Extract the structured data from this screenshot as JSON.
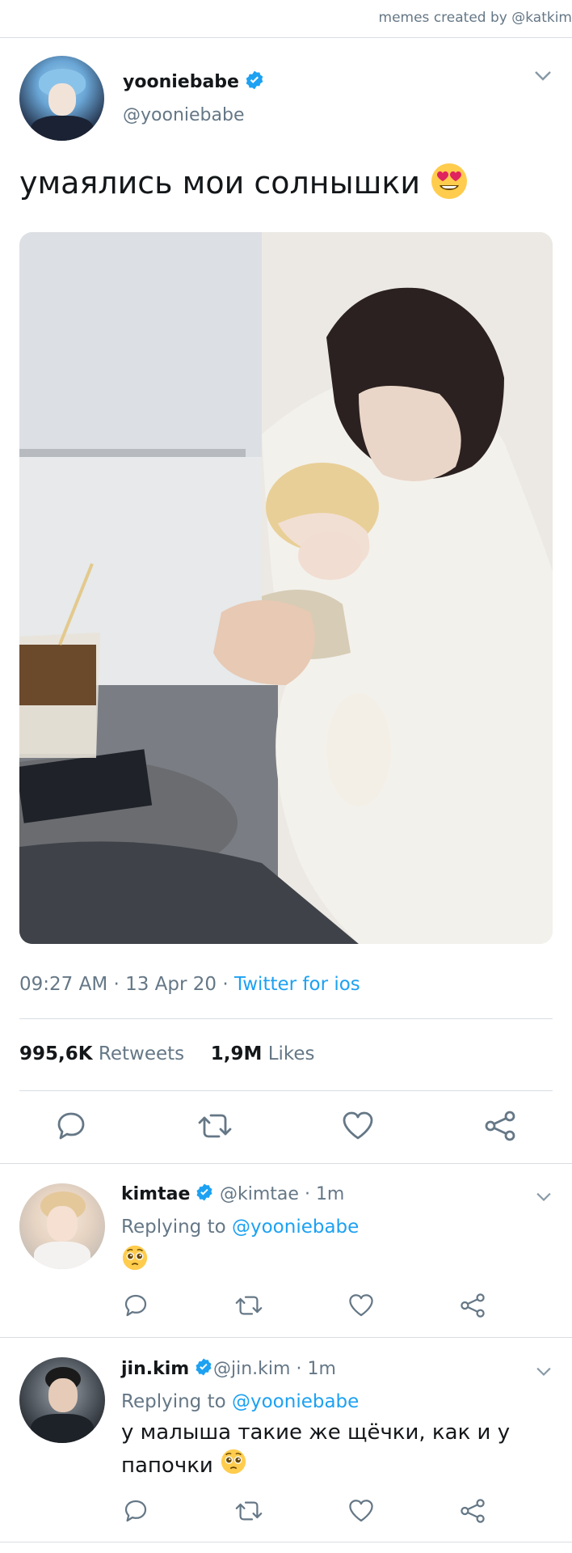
{
  "credit": "memes created by @katkim",
  "tweet": {
    "author_name": "yooniebabe",
    "author_handle": "@yooniebabe",
    "text": "умаялись мои солнышки",
    "text_emoji": "heart-eyes-emoji",
    "time": "09:27 AM",
    "date": "13 Apr 20",
    "source": "Twitter for ios",
    "retweets_count": "995,6K",
    "retweets_label": "Retweets",
    "likes_count": "1,9M",
    "likes_label": "Likes"
  },
  "replies": [
    {
      "author_name": "kimtae",
      "author_handle": "@kimtae",
      "time": "1m",
      "replying_prefix": "Replying to",
      "replying_to": "@yooniebabe",
      "text": "",
      "emoji": "pleading-face-emoji"
    },
    {
      "author_name": "jin.kim",
      "author_handle": "@jin.kim",
      "time": "1m",
      "replying_prefix": "Replying to",
      "replying_to": "@yooniebabe",
      "text_line1": "у малыша такие же щёчки, как и у",
      "text_line2": "папочки",
      "emoji": "pleading-face-emoji"
    }
  ],
  "colors": {
    "accent": "#1da1f2",
    "secondary_text": "#657786",
    "divider": "#d9dee3"
  }
}
